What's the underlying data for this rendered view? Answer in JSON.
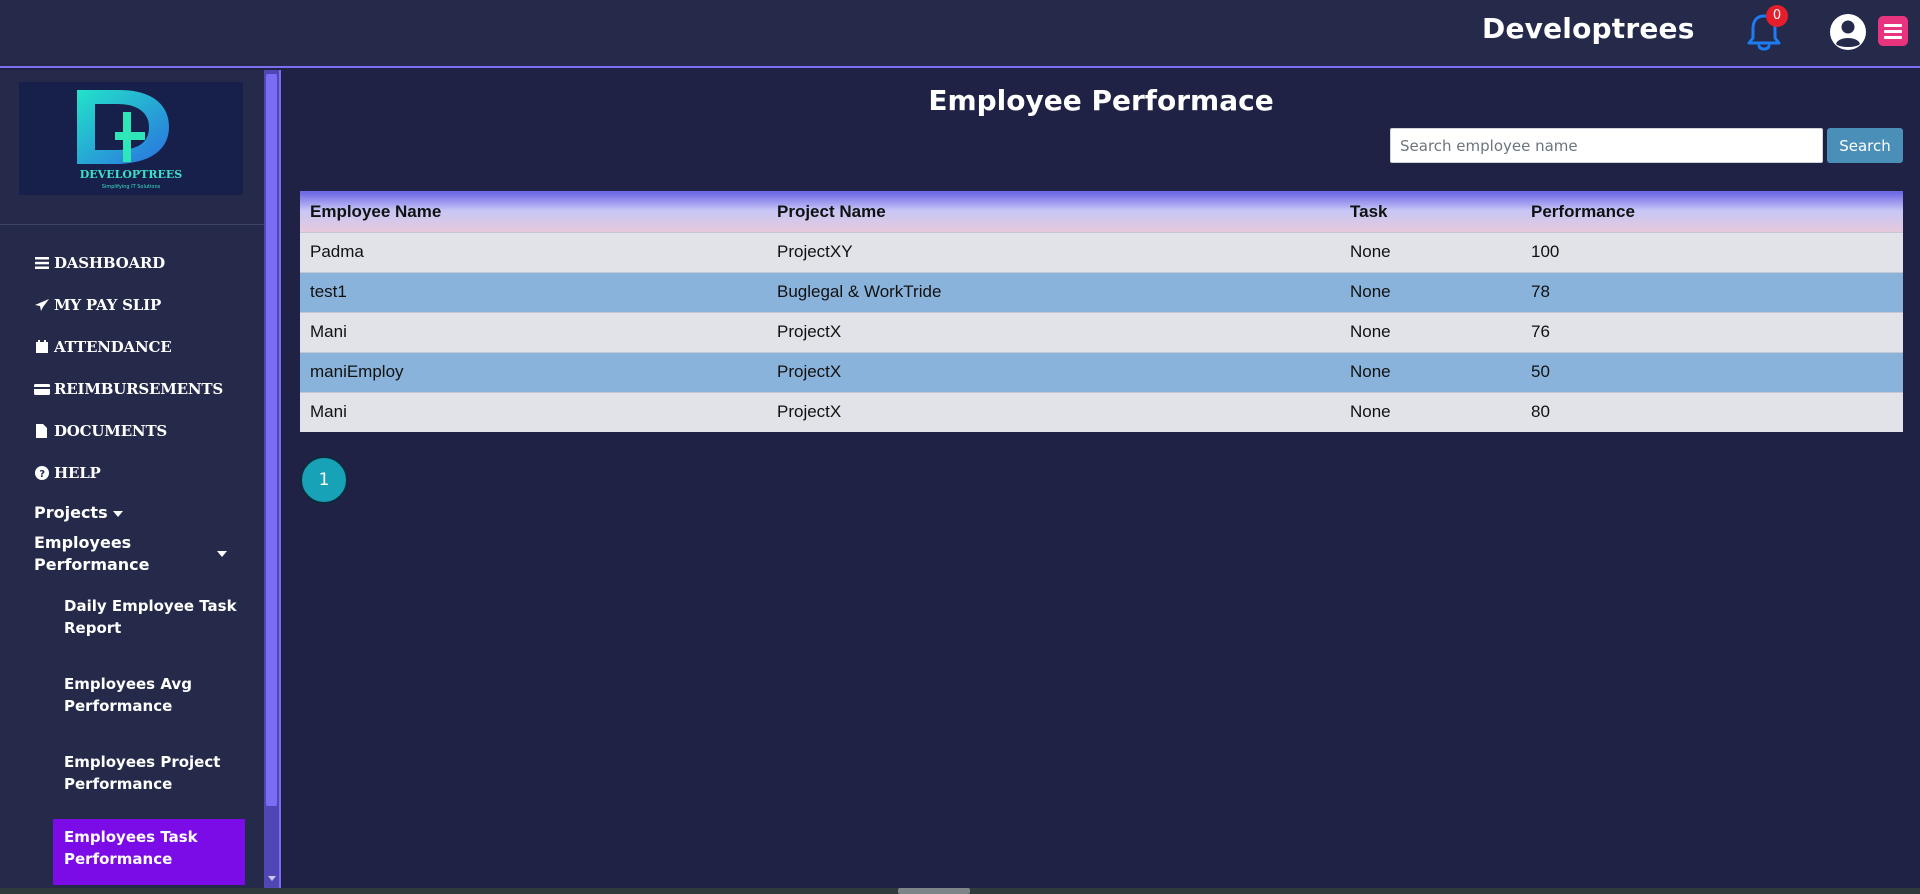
{
  "header": {
    "brand": "Developtrees",
    "notification_count": "0"
  },
  "sidebar": {
    "logo_text": "DEVELOPTREES",
    "logo_tagline": "Simplifying IT Solutions",
    "nav_items": [
      {
        "label": "DASHBOARD",
        "icon": "bars-icon"
      },
      {
        "label": "MY PAY SLIP",
        "icon": "paper-plane-icon"
      },
      {
        "label": "ATTENDANCE",
        "icon": "calendar-icon"
      },
      {
        "label": "REIMBURSEMENTS",
        "icon": "credit-card-icon"
      },
      {
        "label": "DOCUMENTS",
        "icon": "file-icon"
      },
      {
        "label": "HELP",
        "icon": "question-circle-icon"
      }
    ],
    "projects_label": "Projects",
    "employees_performance_label": "Employees Performance",
    "sub_items": [
      {
        "label": "Daily Employee Task Report"
      },
      {
        "label": "Employees Avg Performance"
      },
      {
        "label": "Employees Project Performance"
      },
      {
        "label": "Employees Task Performance",
        "active": true
      }
    ]
  },
  "main": {
    "title": "Employee Performace",
    "search": {
      "placeholder": "Search employee name",
      "value": "",
      "button_label": "Search"
    },
    "table": {
      "headers": [
        "Employee Name",
        "Project Name",
        "Task",
        "Performance"
      ],
      "rows": [
        [
          "Padma",
          "ProjectXY",
          "None",
          "100"
        ],
        [
          "test1",
          "Buglegal & WorkTride",
          "None",
          "78"
        ],
        [
          "Mani",
          "ProjectX",
          "None",
          "76"
        ],
        [
          "maniEmploy",
          "ProjectX",
          "None",
          "50"
        ],
        [
          "Mani",
          "ProjectX",
          "None",
          "80"
        ]
      ]
    },
    "pagination": {
      "current_page": "1"
    }
  },
  "colors": {
    "background": "#1f2244",
    "accent": "#7b6ff0",
    "active_item": "#7b0ce8",
    "badge": "#e51e2b",
    "menu_button": "#e8347e",
    "row_blue": "#8ab3db",
    "row_light": "#e1e3e9"
  }
}
